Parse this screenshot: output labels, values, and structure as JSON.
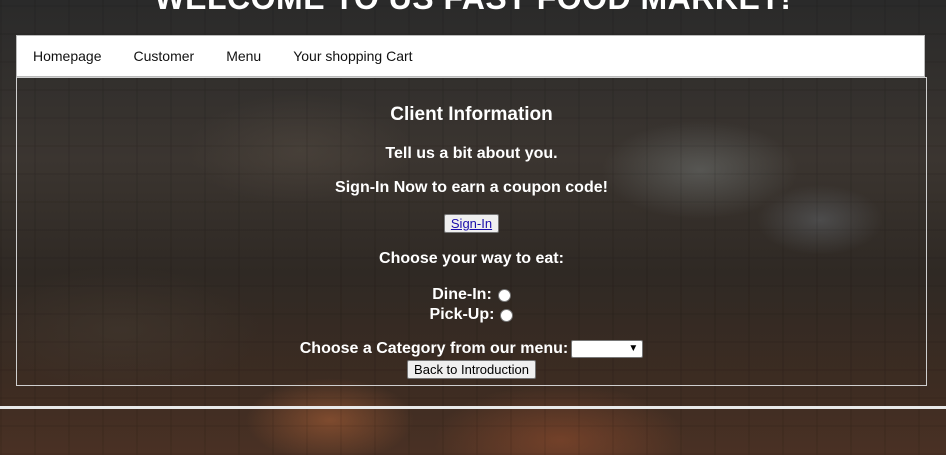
{
  "header": {
    "welcome": "WELCOME TO US FAST FOOD MARKET!"
  },
  "nav": {
    "items": [
      "Homepage",
      "Customer",
      "Menu",
      "Your shopping Cart"
    ]
  },
  "panel": {
    "title": "Client Information",
    "subtitle": "Tell us a bit about you.",
    "signin_prompt": "Sign-In Now to earn a coupon code!",
    "signin_button": "Sign-In",
    "eat_prompt": "Choose your way to eat:",
    "dine_in_label": "Dine-In:",
    "pick_up_label": "Pick-Up:",
    "category_prompt": "Choose a Category from our menu:",
    "category_selected": "",
    "back_button": "Back to Introduction"
  }
}
